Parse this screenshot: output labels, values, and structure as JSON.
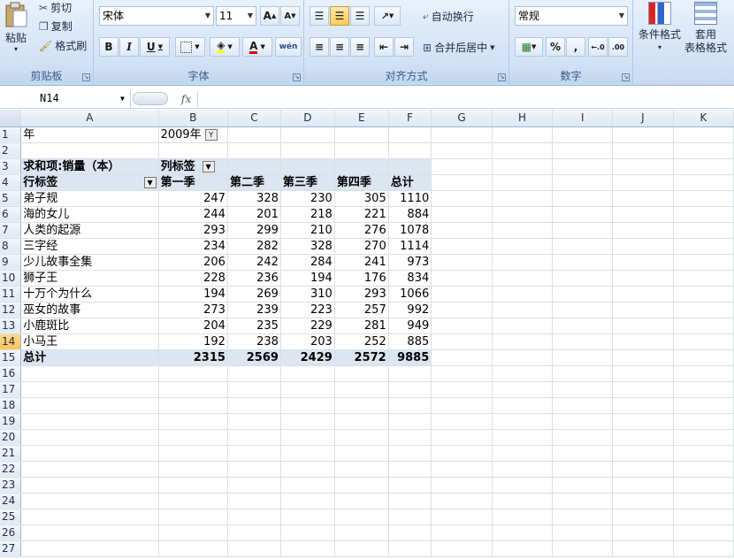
{
  "ribbon": {
    "clipboard": {
      "label": "剪贴板",
      "paste": "粘贴",
      "cut": "剪切",
      "copy": "复制",
      "format_painter": "格式刷"
    },
    "font": {
      "label": "字体",
      "name": "宋体",
      "size": "11",
      "bold": "B",
      "italic": "I",
      "underline": "U",
      "grow": "A",
      "shrink": "A",
      "color_letter": "A",
      "phonetic": "wén"
    },
    "alignment": {
      "label": "对齐方式",
      "wrap_text": "自动换行",
      "merge_center": "合并后居中"
    },
    "number": {
      "label": "数字",
      "format": "常规",
      "percent": "%",
      "comma": ","
    },
    "styles": {
      "conditional": "条件格式",
      "table_format_1": "套用",
      "table_format_2": "表格格式"
    }
  },
  "formula_bar": {
    "cell_ref": "N14",
    "fx": "fx",
    "content": ""
  },
  "columns": [
    "A",
    "B",
    "C",
    "D",
    "E",
    "F",
    "G",
    "H",
    "I",
    "J",
    "K"
  ],
  "rows": [
    {
      "n": "1",
      "cells": [
        "年",
        "2009年",
        "",
        "",
        "",
        ""
      ],
      "filter_b": true
    },
    {
      "n": "2",
      "cells": [
        "",
        "",
        "",
        "",
        "",
        ""
      ]
    },
    {
      "n": "3",
      "cells": [
        "求和项:销量（本）",
        "列标签",
        "",
        "",
        "",
        ""
      ],
      "pivot": true,
      "filter_b": true
    },
    {
      "n": "4",
      "cells": [
        "行标签",
        "第一季",
        "第二季",
        "第三季",
        "第四季",
        "总计"
      ],
      "pivot": true,
      "bold": true,
      "filter_a": true
    },
    {
      "n": "5",
      "cells": [
        "弟子规",
        "247",
        "328",
        "230",
        "305",
        "1110"
      ]
    },
    {
      "n": "6",
      "cells": [
        "海的女儿",
        "244",
        "201",
        "218",
        "221",
        "884"
      ]
    },
    {
      "n": "7",
      "cells": [
        "人类的起源",
        "293",
        "299",
        "210",
        "276",
        "1078"
      ]
    },
    {
      "n": "8",
      "cells": [
        "三字经",
        "234",
        "282",
        "328",
        "270",
        "1114"
      ]
    },
    {
      "n": "9",
      "cells": [
        "少儿故事全集",
        "206",
        "242",
        "284",
        "241",
        "973"
      ]
    },
    {
      "n": "10",
      "cells": [
        "狮子王",
        "228",
        "236",
        "194",
        "176",
        "834"
      ]
    },
    {
      "n": "11",
      "cells": [
        "十万个为什么",
        "194",
        "269",
        "310",
        "293",
        "1066"
      ]
    },
    {
      "n": "12",
      "cells": [
        "巫女的故事",
        "273",
        "239",
        "223",
        "257",
        "992"
      ]
    },
    {
      "n": "13",
      "cells": [
        "小鹿斑比",
        "204",
        "235",
        "229",
        "281",
        "949"
      ]
    },
    {
      "n": "14",
      "cells": [
        "小马王",
        "192",
        "238",
        "203",
        "252",
        "885"
      ]
    },
    {
      "n": "15",
      "cells": [
        "总计",
        "2315",
        "2569",
        "2429",
        "2572",
        "9885"
      ],
      "pivot": true,
      "bold": true
    },
    {
      "n": "16",
      "cells": [
        "",
        "",
        "",
        "",
        "",
        ""
      ]
    },
    {
      "n": "17",
      "cells": [
        "",
        "",
        "",
        "",
        "",
        ""
      ]
    },
    {
      "n": "18",
      "cells": [
        "",
        "",
        "",
        "",
        "",
        ""
      ]
    },
    {
      "n": "19",
      "cells": [
        "",
        "",
        "",
        "",
        "",
        ""
      ]
    },
    {
      "n": "20",
      "cells": [
        "",
        "",
        "",
        "",
        "",
        ""
      ]
    },
    {
      "n": "21",
      "cells": [
        "",
        "",
        "",
        "",
        "",
        ""
      ]
    },
    {
      "n": "22",
      "cells": [
        "",
        "",
        "",
        "",
        "",
        ""
      ]
    },
    {
      "n": "23",
      "cells": [
        "",
        "",
        "",
        "",
        "",
        ""
      ]
    },
    {
      "n": "24",
      "cells": [
        "",
        "",
        "",
        "",
        "",
        ""
      ]
    },
    {
      "n": "25",
      "cells": [
        "",
        "",
        "",
        "",
        "",
        ""
      ]
    },
    {
      "n": "26",
      "cells": [
        "",
        "",
        "",
        "",
        "",
        ""
      ]
    },
    {
      "n": "27",
      "cells": [
        "",
        "",
        "",
        "",
        "",
        ""
      ]
    }
  ]
}
